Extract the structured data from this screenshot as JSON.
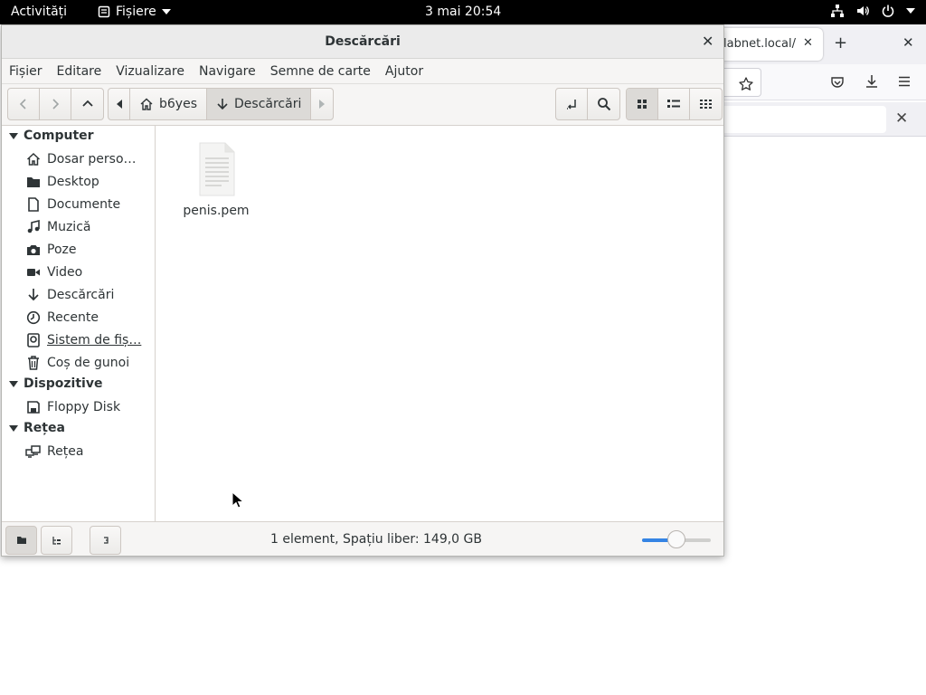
{
  "topbar": {
    "activities": "Activități",
    "app_menu": "Fișiere",
    "clock": "3 mai  20:54",
    "icons": [
      "network-icon",
      "volume-icon",
      "power-icon",
      "chevron-down-icon"
    ]
  },
  "browser": {
    "tab_title": "labnet.local/",
    "new_tab": "+",
    "close": "✕"
  },
  "window": {
    "title": "Descărcări",
    "close": "✕"
  },
  "menubar": [
    "Fișier",
    "Editare",
    "Vizualizare",
    "Navigare",
    "Semne de carte",
    "Ajutor"
  ],
  "toolbar": {
    "breadcrumbs": [
      {
        "label": "b6yes",
        "icon": "home-icon"
      },
      {
        "label": "Descărcări",
        "icon": "download-icon"
      }
    ],
    "view_mode": "grid"
  },
  "sidebar": {
    "sections": [
      {
        "title": "Computer",
        "items": [
          {
            "label": "Dosar perso…",
            "icon": "home-icon"
          },
          {
            "label": "Desktop",
            "icon": "folder-icon"
          },
          {
            "label": "Documente",
            "icon": "document-icon"
          },
          {
            "label": "Muzică",
            "icon": "music-icon"
          },
          {
            "label": "Poze",
            "icon": "camera-icon"
          },
          {
            "label": "Video",
            "icon": "video-icon"
          },
          {
            "label": "Descărcări",
            "icon": "download-icon"
          },
          {
            "label": "Recente",
            "icon": "clock-icon"
          },
          {
            "label": "Sistem de fiș…",
            "icon": "drive-icon"
          },
          {
            "label": "Coș de gunoi",
            "icon": "trash-icon"
          }
        ]
      },
      {
        "title": "Dispozitive",
        "items": [
          {
            "label": "Floppy Disk",
            "icon": "floppy-icon"
          }
        ]
      },
      {
        "title": "Rețea",
        "items": [
          {
            "label": "Rețea",
            "icon": "network-icon"
          }
        ]
      }
    ]
  },
  "files": [
    {
      "name": "penis.pem",
      "icon": "text-file-icon"
    }
  ],
  "statusbar": {
    "text": "1 element, Spațiu liber: 149,0 GB",
    "zoom_level": 0.5
  },
  "colors": {
    "accent": "#3584e4",
    "topbar": "#000000",
    "headerbar": "#ebebeb"
  }
}
